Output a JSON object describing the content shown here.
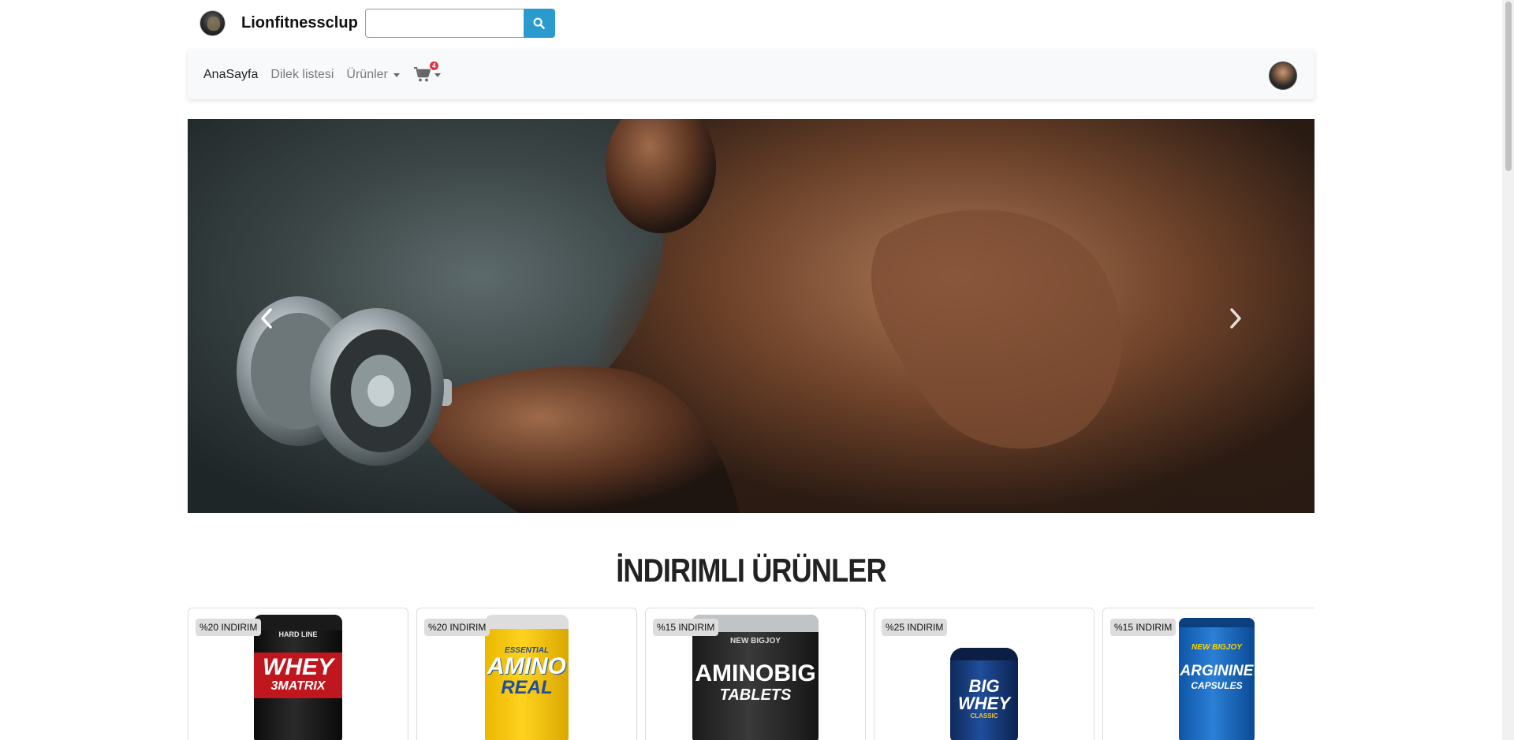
{
  "header": {
    "brand": "Lionfitnessclup",
    "search": {
      "value": "",
      "placeholder": ""
    }
  },
  "nav": {
    "items": [
      {
        "label": "AnaSayfa"
      },
      {
        "label": "Dilek listesi"
      },
      {
        "label": "Ürünler"
      }
    ],
    "cart_count": "4"
  },
  "section": {
    "title": "İNDIRIMLI ÜRÜNLER"
  },
  "products": [
    {
      "discount": "%20 INDIRIM",
      "name_line1": "WHEY",
      "name_line2": "3MATRIX",
      "top_text": "HARD LINE"
    },
    {
      "discount": "%20 INDIRIM",
      "name_line1": "AMINO",
      "name_line2": "REAL",
      "top_text": "ESSENTIAL"
    },
    {
      "discount": "%15 INDIRIM",
      "name_line1": "AMINOBIG",
      "name_line2": "TABLETS",
      "top_text": "NEW BIGJOY"
    },
    {
      "discount": "%25 INDIRIM",
      "name_line1": "BIG",
      "name_line2": "WHEY",
      "top_text": "CLASSIC"
    },
    {
      "discount": "%15 INDIRIM",
      "name_line1": "ARGININE",
      "name_line2": "CAPSULES",
      "top_text": "NEW BIGJOY"
    }
  ],
  "colors": {
    "search_button": "#2b9bcf",
    "cart_badge": "#dc3545",
    "navbar_bg": "#f8f9fa"
  }
}
